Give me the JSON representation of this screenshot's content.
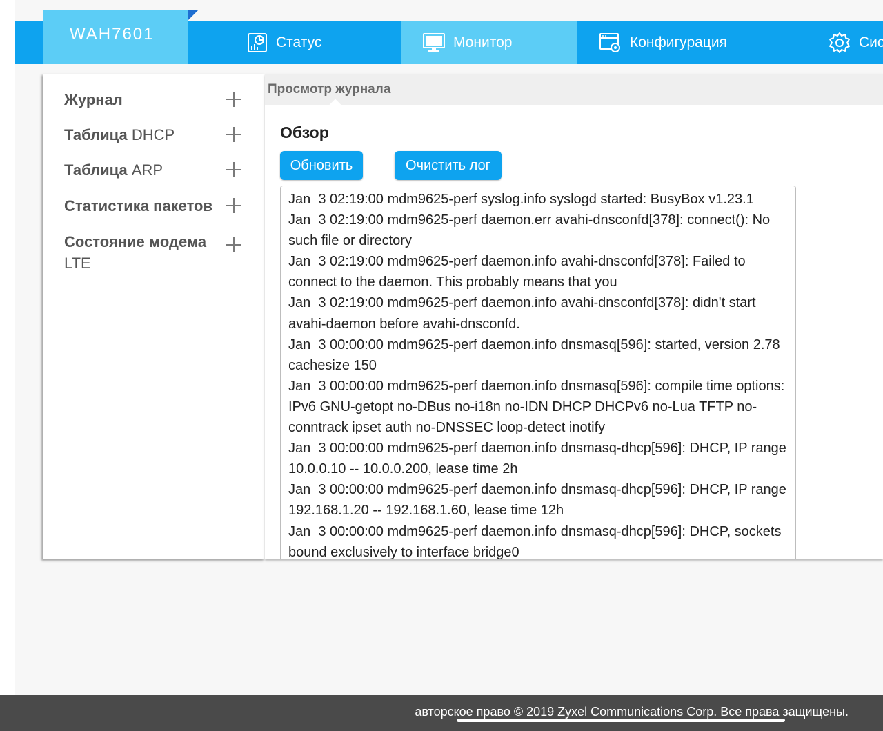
{
  "header": {
    "brand": "WAH7601",
    "nav": [
      {
        "label": "Статус",
        "icon": "status-chart-icon"
      },
      {
        "label": "Монитор",
        "icon": "monitor-icon"
      },
      {
        "label": "Конфигурация",
        "icon": "configuration-window-icon"
      },
      {
        "label": "Сис",
        "icon": "gear-icon"
      }
    ],
    "active_nav": "Монитор"
  },
  "sidebar": {
    "items": [
      {
        "bold": "Журнал",
        "light": ""
      },
      {
        "bold": "Таблица ",
        "light": "DHCP"
      },
      {
        "bold": "Таблица ",
        "light": "ARP"
      },
      {
        "bold": "Статистика пакетов",
        "light": ""
      },
      {
        "bold": "Состояние модема",
        "light": "LTE"
      }
    ]
  },
  "main": {
    "tab_title": "Просмотр журнала",
    "section_title": "Обзор",
    "refresh_label": "Обновить",
    "clear_label": "Очистить лог",
    "log_lines": [
      "Jan  3 02:19:00 mdm9625-perf syslog.info syslogd started: BusyBox v1.23.1",
      "Jan  3 02:19:00 mdm9625-perf daemon.err avahi-dnsconfd[378]: connect(): No such file or directory",
      "Jan  3 02:19:00 mdm9625-perf daemon.info avahi-dnsconfd[378]: Failed to connect to the daemon. This probably means that you",
      "Jan  3 02:19:00 mdm9625-perf daemon.info avahi-dnsconfd[378]: didn't start avahi-daemon before avahi-dnsconfd.",
      "Jan  3 00:00:00 mdm9625-perf daemon.info dnsmasq[596]: started, version 2.78 cachesize 150",
      "Jan  3 00:00:00 mdm9625-perf daemon.info dnsmasq[596]: compile time options: IPv6 GNU-getopt no-DBus no-i18n no-IDN DHCP DHCPv6 no-Lua TFTP no-conntrack ipset auth no-DNSSEC loop-detect inotify",
      "Jan  3 00:00:00 mdm9625-perf daemon.info dnsmasq-dhcp[596]: DHCP, IP range 10.0.0.10 -- 10.0.0.200, lease time 2h",
      "Jan  3 00:00:00 mdm9625-perf daemon.info dnsmasq-dhcp[596]: DHCP, IP range 192.168.1.20 -- 192.168.1.60, lease time 12h",
      "Jan  3 00:00:00 mdm9625-perf daemon.info dnsmasq-dhcp[596]: DHCP, sockets bound exclusively to interface bridge0"
    ]
  },
  "footer": {
    "copyright": "авторское право © 2019 Zyxel Communications Corp. Все права защищены."
  },
  "colors": {
    "accent": "#0ea3ef",
    "accent_light": "#5ccdf6",
    "footer": "#4a4a4a"
  }
}
